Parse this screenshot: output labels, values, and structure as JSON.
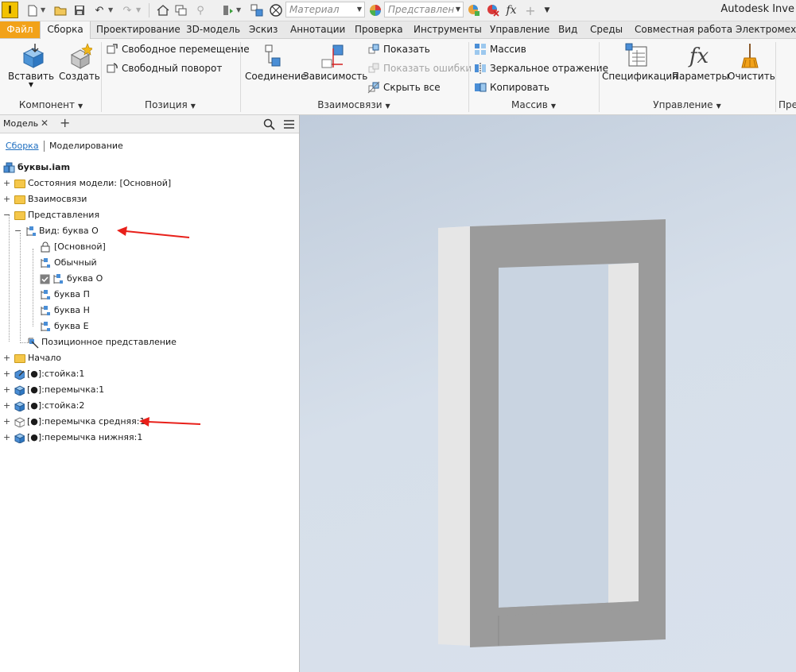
{
  "app": {
    "logo_letter": "I",
    "title": "Autodesk Inve"
  },
  "qat": {
    "material_placeholder": "Материал",
    "appearance_placeholder": "Представлен",
    "fx_label": "fx"
  },
  "tabs": [
    {
      "label": "Файл"
    },
    {
      "label": "Сборка"
    },
    {
      "label": "Проектирование"
    },
    {
      "label": "3D-модель"
    },
    {
      "label": "Эскиз"
    },
    {
      "label": "Аннотации"
    },
    {
      "label": "Проверка"
    },
    {
      "label": "Инструменты"
    },
    {
      "label": "Управление"
    },
    {
      "label": "Вид"
    },
    {
      "label": "Среды"
    },
    {
      "label": "Совместная работа"
    },
    {
      "label": "Электромеханика"
    }
  ],
  "ribbon": {
    "component": {
      "title": "Компонент",
      "insert": "Вставить",
      "create": "Создать"
    },
    "position": {
      "title": "Позиция",
      "free_move": "Свободное перемещение",
      "free_rotate": "Свободный поворот"
    },
    "relationships": {
      "title": "Взаимосвязи",
      "joint": "Соединение",
      "constrain": "Зависимость",
      "show": "Показать",
      "show_sick": "Показать ошибки",
      "hide_all": "Скрыть все"
    },
    "pattern": {
      "title": "Массив",
      "pattern": "Массив",
      "mirror": "Зеркальное отражение",
      "copy": "Копировать"
    },
    "manage": {
      "title": "Управление",
      "bom": "Спецификация",
      "parameters": "Параметры",
      "purge": "Очистить",
      "fx": "fx"
    },
    "next_title": "Пре"
  },
  "browser": {
    "tab_label": "Модель",
    "close": "✕",
    "add": "+",
    "mode_assembly": "Сборка",
    "mode_modeling": "Моделирование",
    "tree": [
      {
        "label": "буквы.iam"
      },
      {
        "label": "Состояния модели: [Основной]"
      },
      {
        "label": "Взаимосвязи"
      },
      {
        "label": "Представления"
      },
      {
        "label": "Вид: буква О"
      },
      {
        "label": "[Основной]"
      },
      {
        "label": "Обычный"
      },
      {
        "label": "буква О"
      },
      {
        "label": "буква П"
      },
      {
        "label": "буква Н"
      },
      {
        "label": "буква Е"
      },
      {
        "label": "Позиционное представление"
      },
      {
        "label": "Начало"
      },
      {
        "label": "[●]:стойка:1"
      },
      {
        "label": "[●]:перемычка:1"
      },
      {
        "label": "[●]:стойка:2"
      },
      {
        "label": "[●]:перемычка средняя:1"
      },
      {
        "label": "[●]:перемычка нижняя:1"
      }
    ]
  },
  "colors": {
    "file_tab": "#f2a219",
    "annotation_arrow": "#e8201a",
    "model_face": "#9b9b9b",
    "model_side": "#e6e6e6",
    "viewport_top": "#c0ccdb"
  }
}
